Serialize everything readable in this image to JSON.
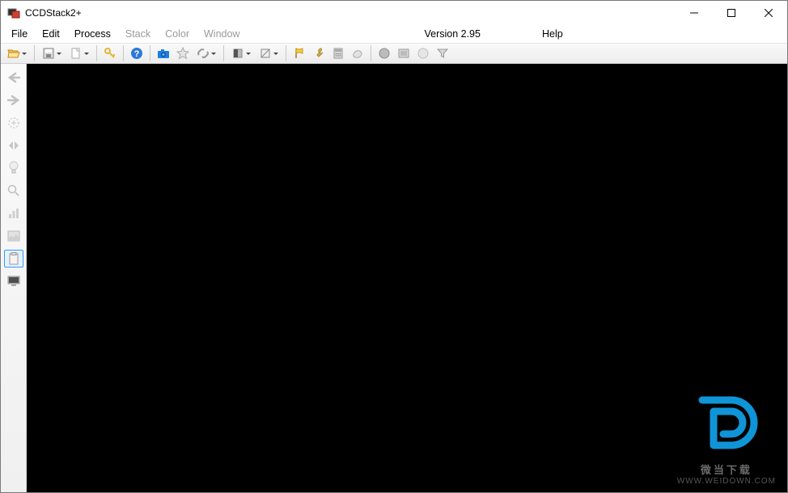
{
  "window": {
    "title": "CCDStack2+"
  },
  "menu": {
    "file": "File",
    "edit": "Edit",
    "process": "Process",
    "stack": "Stack",
    "color": "Color",
    "windowm": "Window",
    "version": "Version 2.95",
    "help": "Help"
  },
  "watermark": {
    "name": "微当下载",
    "url": "WWW.WEIDOWN.COM"
  }
}
